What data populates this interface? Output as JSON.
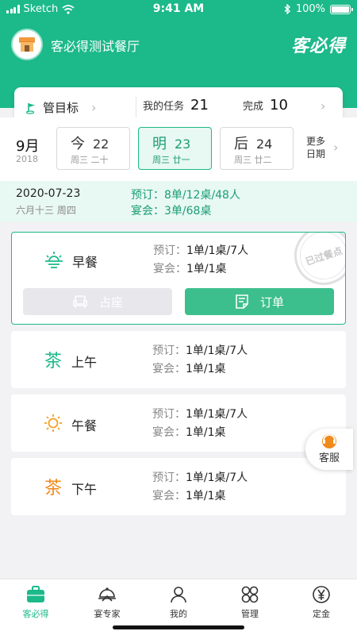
{
  "status_bar": {
    "carrier": "Sketch",
    "time": "9:41 AM",
    "battery": "100%"
  },
  "header": {
    "store_name": "客必得测试餐厅",
    "brand_logo_text": "客必得"
  },
  "task_card": {
    "goal_label": "管目标",
    "my_tasks_label": "我的任务",
    "my_tasks_count": "21",
    "completed_label": "完成",
    "completed_count": "10"
  },
  "date_bar": {
    "month": "9月",
    "year": "2018",
    "days": [
      {
        "rel": "今",
        "day": "22",
        "sub": "周三 二十",
        "active": false
      },
      {
        "rel": "明",
        "day": "23",
        "sub": "周三 廿一",
        "active": true
      },
      {
        "rel": "后",
        "day": "24",
        "sub": "周三 廿二",
        "active": false
      }
    ],
    "more_line1": "更多",
    "more_line2": "日期"
  },
  "summary": {
    "date": "2020-07-23",
    "lunar": "六月十三 周四",
    "booking_line": "预订：8单/12桌/48人",
    "banquet_line": "宴会：3单/68桌"
  },
  "meals": [
    {
      "name": "早餐",
      "icon": "sunrise-icon",
      "booking_label": "预订：",
      "booking": "1单/1桌/7人",
      "banquet_label": "宴会：",
      "banquet": "1单/1桌",
      "stamp": "已过餐点"
    },
    {
      "name": "上午",
      "icon": "tea-icon",
      "booking_label": "预订：",
      "booking": "1单/1桌/7人",
      "banquet_label": "宴会：",
      "banquet": "1单/1桌"
    },
    {
      "name": "午餐",
      "icon": "sun-icon",
      "booking_label": "预订：",
      "booking": "1单/1桌/7人",
      "banquet_label": "宴会：",
      "banquet": "1单/1桌"
    },
    {
      "name": "下午",
      "icon": "tea-icon",
      "booking_label": "预订：",
      "booking": "1单/1桌/7人",
      "banquet_label": "宴会：",
      "banquet": "1单/1桌"
    }
  ],
  "actions": {
    "seat_label": "占座",
    "order_label": "订单"
  },
  "float_service": {
    "label": "客服"
  },
  "tabs": [
    {
      "label": "客必得",
      "active": true
    },
    {
      "label": "宴专家",
      "active": false
    },
    {
      "label": "我的",
      "active": false
    },
    {
      "label": "管理",
      "active": false
    },
    {
      "label": "定金",
      "active": false
    }
  ],
  "colors": {
    "primary": "#1cb98a",
    "button_green": "#3dbf8d",
    "light_bg": "#e8f8f2",
    "tea_green": "#1cb98a",
    "tea_orange": "#f08a1c",
    "sun_orange": "#f3a126"
  }
}
